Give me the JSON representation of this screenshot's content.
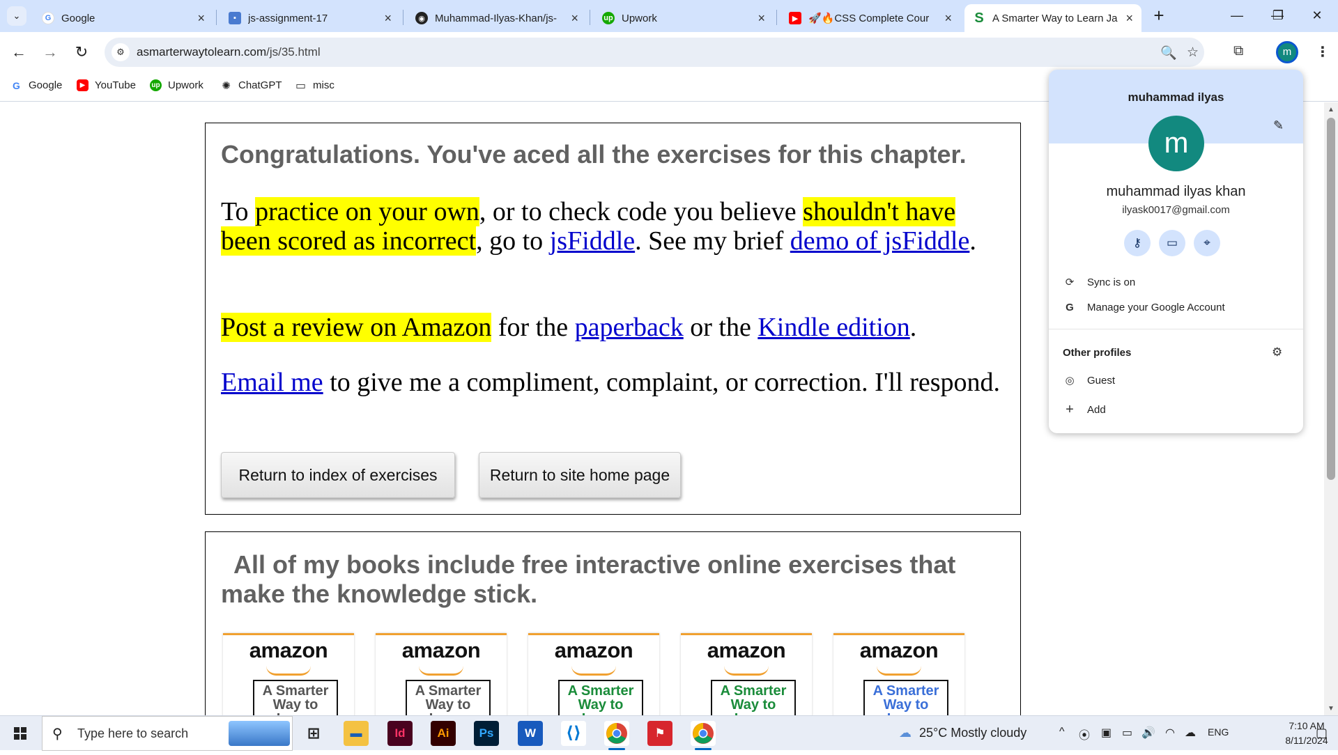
{
  "tabs": [
    {
      "title": "Google",
      "icon": "google-icon",
      "active": false
    },
    {
      "title": "js-assignment-17",
      "icon": "contact-icon",
      "active": false
    },
    {
      "title": "Muhammad-Ilyas-Khan/js-",
      "icon": "github-icon",
      "active": false
    },
    {
      "title": "Upwork",
      "icon": "upwork-icon",
      "active": false
    },
    {
      "title": "🚀🔥CSS Complete Cour",
      "icon": "youtube-icon",
      "active": false
    },
    {
      "title": "A Smarter Way to Learn Ja",
      "icon": "smarter-way-icon",
      "active": true
    }
  ],
  "address": {
    "url_host": "asmarterwaytolearn.com",
    "url_path": "/js/35.html"
  },
  "bookmarks": [
    {
      "label": "Google",
      "icon": "google-icon"
    },
    {
      "label": "YouTube",
      "icon": "youtube-icon"
    },
    {
      "label": "Upwork",
      "icon": "upwork-icon"
    },
    {
      "label": "ChatGPT",
      "icon": "chatgpt-icon"
    },
    {
      "label": "misc",
      "icon": "folder-icon"
    }
  ],
  "content": {
    "congrats_heading": "Congratulations. You've aced all the exercises for this chapter.",
    "p1": {
      "t1": "To ",
      "hl1": "practice on your own",
      "t2": ", or to check code you believe ",
      "hl2": "shouldn't have been scored as incorrect",
      "t3": ", go to ",
      "link1": "jsFiddle",
      "t4": ". See my brief ",
      "link2": "demo of jsFiddle",
      "t5": "."
    },
    "p2": {
      "hl": "Post a review on Amazon",
      "t1": " for the ",
      "link1": "paperback",
      "t2": " or the ",
      "link2": "Kindle edition",
      "t3": "."
    },
    "p3": {
      "link": "Email me",
      "t1": " to give me a compliment, complaint, or correction. I'll respond."
    },
    "btn_index": "Return to index of exercises",
    "btn_home": "Return to site home page",
    "books_heading": "All of my books include free interactive online exercises that make the knowledge stick.",
    "books": [
      {
        "brand": "amazon",
        "title": "A Smarter Way to Learn",
        "color": "#555555"
      },
      {
        "brand": "amazon",
        "title": "A Smarter Way to Learn",
        "color": "#555555"
      },
      {
        "brand": "amazon",
        "title": "A Smarter Way to Learn",
        "color": "#1a8c3a"
      },
      {
        "brand": "amazon",
        "title": "A Smarter Way to Learn",
        "color": "#1a8c3a"
      },
      {
        "brand": "amazon",
        "title": "A Smarter Way to Learn",
        "color": "#3a6fd8"
      }
    ]
  },
  "profile": {
    "name": "muhammad ilyas",
    "avatar_letter": "m",
    "full_name": "muhammad ilyas khan",
    "email": "ilyask0017@gmail.com",
    "sync": "Sync is on",
    "manage": "Manage your Google Account",
    "other_profiles": "Other profiles",
    "guest": "Guest",
    "add": "Add"
  },
  "taskbar": {
    "search_placeholder": "Type here to search",
    "weather": "25°C  Mostly cloudy",
    "lang": "ENG",
    "time": "7:10 AM",
    "date": "8/11/2024"
  },
  "colors": {
    "highlight": "#ffff00",
    "link": "#0000cc",
    "heading": "#616161",
    "chrome_accent": "#d3e3fd",
    "avatar": "#12897f"
  }
}
